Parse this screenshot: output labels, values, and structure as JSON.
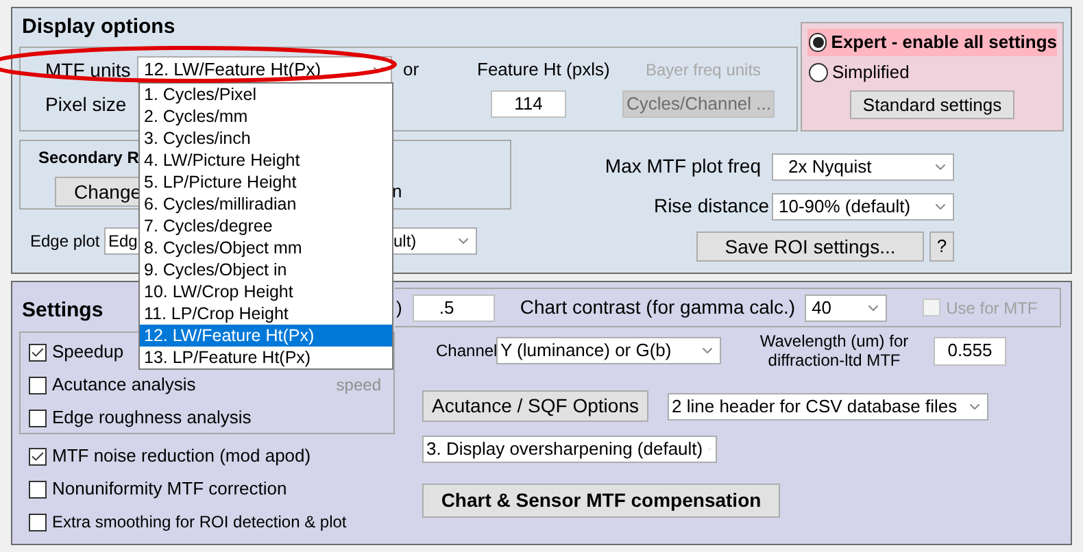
{
  "display_options": {
    "title": "Display options",
    "mtf_units": {
      "label": "MTF units",
      "value": "12. LW/Feature Ht(Px)",
      "options": [
        {
          "label": "1. Cycles/Pixel",
          "selected": false
        },
        {
          "label": "2. Cycles/mm",
          "selected": false
        },
        {
          "label": "3. Cycles/inch",
          "selected": false
        },
        {
          "label": "4. LW/Picture Height",
          "selected": false
        },
        {
          "label": "5. LP/Picture Height",
          "selected": false
        },
        {
          "label": "6. Cycles/milliradian",
          "selected": false
        },
        {
          "label": "7. Cycles/degree",
          "selected": false
        },
        {
          "label": "8. Cycles/Object mm",
          "selected": false
        },
        {
          "label": "9. Cycles/Object in",
          "selected": false
        },
        {
          "label": "10. LW/Crop Height",
          "selected": false
        },
        {
          "label": "11. LP/Crop Height",
          "selected": false
        },
        {
          "label": "12. LW/Feature Ht(Px)",
          "selected": true
        },
        {
          "label": "13. LP/Feature Ht(Px)",
          "selected": false
        }
      ]
    },
    "partial_label": "or",
    "feature_ht": {
      "label": "Feature Ht (pxls)",
      "value": "114"
    },
    "bayer_freq_units": {
      "label": "Bayer freq units",
      "value": "Cycles/Channel ...",
      "disabled": true
    },
    "pixel_size": {
      "label": "Pixel size"
    },
    "mode": {
      "options": [
        {
          "label": "Expert - enable all settings",
          "selected": true
        },
        {
          "label": "Simplified",
          "selected": false
        }
      ],
      "button": "Standard settings"
    },
    "secondary": {
      "title": "Secondary R",
      "button": "Change",
      "partial_text": "n"
    },
    "max_mtf_plot_freq": {
      "label": "Max MTF plot freq",
      "value": "2x Nyquist"
    },
    "rise_distance": {
      "label": "Rise distance",
      "value": "10-90% (default)"
    },
    "save_button": "Save ROI settings...",
    "help_button": "?",
    "edge_plot": {
      "label": "Edge plot",
      "value_start": "Edg",
      "value_end": "ult)"
    }
  },
  "settings": {
    "title": "Settings",
    "partial_label": ")",
    "threshold_value": ".5",
    "chart_contrast": {
      "label": "Chart contrast (for gamma calc.)",
      "value": "40"
    },
    "use_for_mtf": {
      "label": "Use for MTF",
      "checked": false,
      "disabled": true
    },
    "group_checks": [
      {
        "label": "Speedup",
        "checked": true
      },
      {
        "label": "Acutance analysis",
        "checked": false
      },
      {
        "label": "Edge roughness analysis",
        "checked": false
      }
    ],
    "partial_hint": "speed",
    "checks": [
      {
        "label": "MTF noise reduction (mod apod)",
        "checked": true
      },
      {
        "label": "Nonuniformity MTF correction",
        "checked": false
      },
      {
        "label": "Extra smoothing for ROI detection & plot",
        "checked": false
      }
    ],
    "channel": {
      "label": "Channel",
      "value": "Y (luminance) or G(b)"
    },
    "wavelength": {
      "label": "Wavelength (um) for diffraction-ltd MTF",
      "value": "0.555"
    },
    "acutance_button": "Acutance / SQF Options",
    "csv_header": {
      "value": "2 line header for CSV database files"
    },
    "oversharpening": {
      "value": "3. Display oversharpening (default)"
    },
    "compensation_button": "Chart & Sensor MTF compensation"
  }
}
